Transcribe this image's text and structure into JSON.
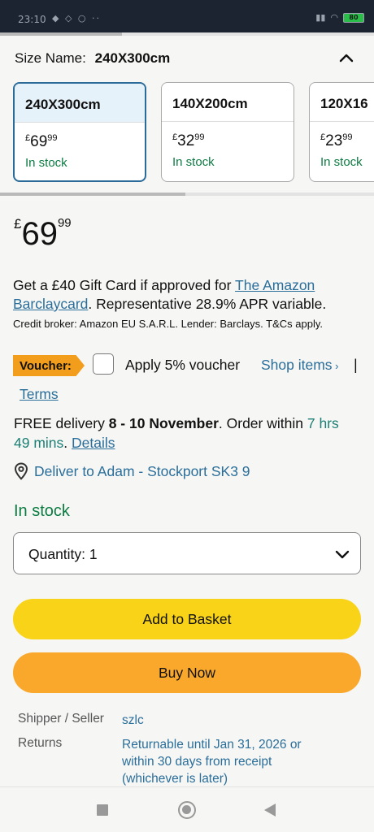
{
  "status_bar": {
    "time": "23:10",
    "battery": "80"
  },
  "size_selector": {
    "label": "Size Name:",
    "selected": "240X300cm",
    "options": [
      {
        "name": "240X300cm",
        "price_currency": "£",
        "price_whole": "69",
        "price_fraction": "99",
        "stock": "In stock",
        "selected": true
      },
      {
        "name": "140X200cm",
        "price_currency": "£",
        "price_whole": "32",
        "price_fraction": "99",
        "stock": "In stock",
        "selected": false
      },
      {
        "name": "120X16",
        "price_currency": "£",
        "price_whole": "23",
        "price_fraction": "99",
        "stock": "In stock",
        "selected": false
      }
    ]
  },
  "price": {
    "currency": "£",
    "whole": "69",
    "fraction": "99"
  },
  "gift_card": {
    "text_before": "Get a £40 Gift Card if approved for ",
    "link": "The Amazon Barclaycard",
    "text_after": ". Representative 28.9% APR variable.",
    "credit_note": "Credit broker: Amazon EU S.A.R.L. Lender: Barclays. T&Cs apply."
  },
  "voucher": {
    "badge": "Voucher:",
    "text": "Apply 5% voucher",
    "shop_items": "Shop items",
    "separator": "|",
    "terms": "Terms"
  },
  "delivery": {
    "prefix": "FREE delivery ",
    "dates": "8 - 10 November",
    "middle": ". Order within ",
    "countdown": "7 hrs 49 mins",
    "dot": ". ",
    "details": "Details"
  },
  "deliver_to": "Deliver to Adam - Stockport SK3 9",
  "availability": "In stock",
  "quantity": {
    "label": "Quantity:",
    "value": "1"
  },
  "buttons": {
    "add_to_basket": "Add to Basket",
    "buy_now": "Buy Now"
  },
  "info": {
    "shipper_label": "Shipper / Seller",
    "shipper_value": "szlc",
    "returns_label": "Returns",
    "returns_value": "Returnable until Jan 31, 2026 or within 30 days from receipt (whichever is later)"
  },
  "colors": {
    "link": "#2a6e9a",
    "in_stock": "#0c7c42",
    "add_to_basket": "#f8d318",
    "buy_now": "#f9a82c",
    "voucher_badge": "#f29d1c",
    "selected_border": "#2b6b99"
  }
}
